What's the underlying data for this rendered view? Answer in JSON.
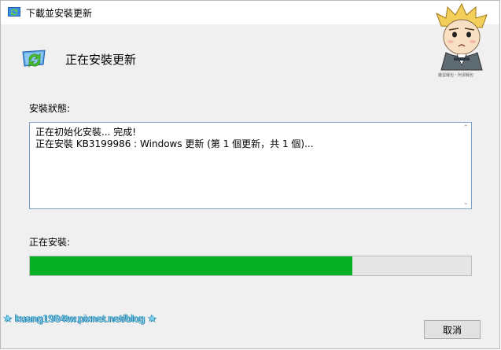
{
  "window": {
    "title": "下載並安裝更新",
    "icons": {
      "title": "windows-update-icon",
      "header": "windows-update-icon",
      "mascot": "mascot-avatar"
    },
    "mascot_caption": "雞蛋麵包・阿湯麵包"
  },
  "header": {
    "title": "正在安裝更新"
  },
  "status": {
    "label": "安裝狀態:",
    "lines": [
      "正在初始化安裝... 完成!",
      "正在安裝 KB3199986 : Windows 更新 (第 1 個更新，共 1 個)..."
    ]
  },
  "progress": {
    "label": "正在安裝:",
    "value": 0.73
  },
  "buttons": {
    "cancel": "取消"
  },
  "watermark": "★ kuang1984tw.pixnet.net/blog ★",
  "colors": {
    "progress_fill": "#06b025",
    "accent_border": "#7a9fc9"
  }
}
